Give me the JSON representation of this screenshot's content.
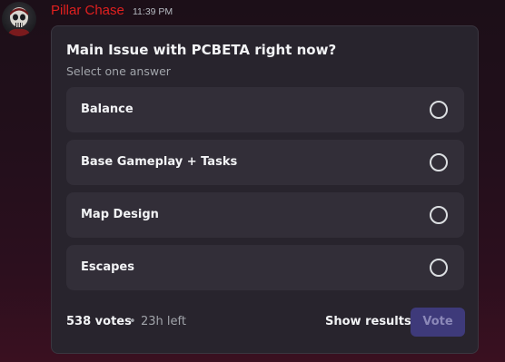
{
  "message": {
    "username": "Pillar Chase",
    "timestamp": "11:39 PM",
    "avatar_icon": "skull-mask-avatar-icon"
  },
  "poll": {
    "question": "Main Issue with PCBETA right now?",
    "subtitle": "Select one answer",
    "answers": [
      {
        "label": "Balance",
        "selected": false
      },
      {
        "label": "Base Gameplay + Tasks",
        "selected": false
      },
      {
        "label": "Map Design",
        "selected": false
      },
      {
        "label": "Escapes",
        "selected": false
      }
    ],
    "votes": "538 votes",
    "separator": "•",
    "time_left": "23h left",
    "show_results_label": "Show results",
    "vote_label": "Vote"
  },
  "colors": {
    "username": "#e0201f",
    "vote_button_bg": "#3e3a7a",
    "poll_bg": "#28242d",
    "answer_bg": "#322e38"
  }
}
